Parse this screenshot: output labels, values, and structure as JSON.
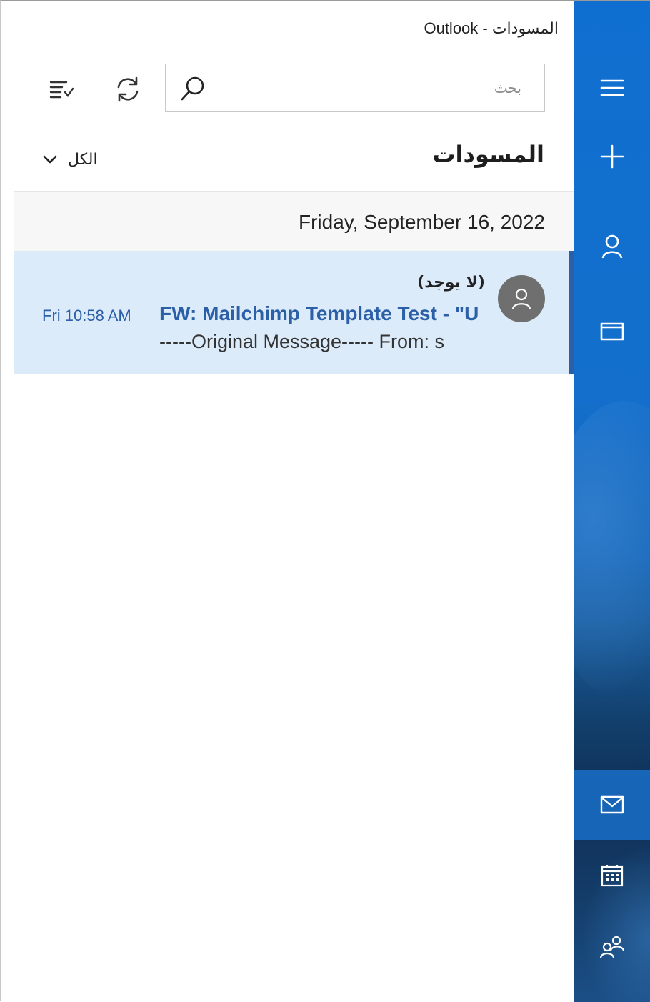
{
  "window": {
    "title": "المسودات - Outlook"
  },
  "rail": {
    "items": [
      {
        "name": "menu",
        "icon": "hamburger-icon"
      },
      {
        "name": "new-mail",
        "icon": "plus-icon"
      },
      {
        "name": "accounts",
        "icon": "person-icon"
      },
      {
        "name": "folders",
        "icon": "folder-icon"
      },
      {
        "name": "mail",
        "icon": "mail-icon",
        "active": true
      },
      {
        "name": "calendar",
        "icon": "calendar-icon"
      },
      {
        "name": "people",
        "icon": "people-icon"
      }
    ],
    "colors": {
      "top": "#0f6fd0",
      "bottom": "#0f2f55",
      "active": "#196ec8"
    }
  },
  "toolbar": {
    "search_placeholder": "بحث",
    "search_value": "",
    "sync_icon": "sync-icon",
    "select_icon": "select-mode-icon"
  },
  "folder": {
    "title": "المسودات",
    "filter_label": "الكل"
  },
  "groups": [
    {
      "date": "Friday, September 16, 2022",
      "messages": [
        {
          "sender": "(لا يوجد)",
          "subject": "FW: Mailchimp Template Test - \"U",
          "time": "Fri 10:58 AM",
          "preview": "-----Original Message----- From: s",
          "selected": true
        }
      ]
    }
  ],
  "colors": {
    "accent": "#2b5fa8",
    "selected_bg": "#dcebf9",
    "avatar": "#6f6f6f"
  }
}
